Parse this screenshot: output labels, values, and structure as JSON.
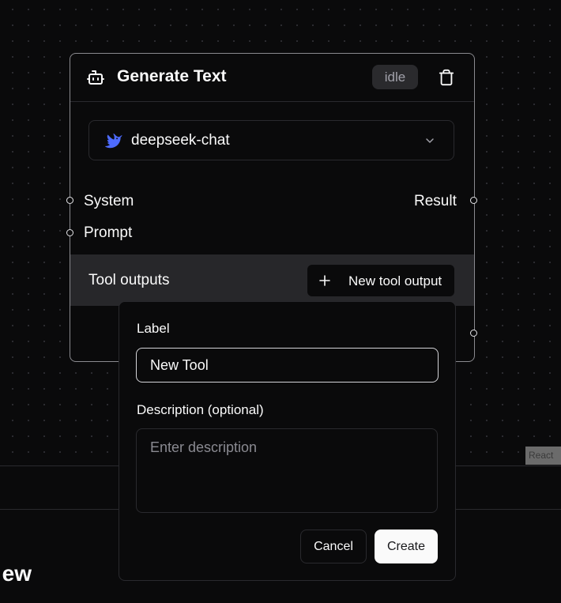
{
  "node": {
    "title": "Generate Text",
    "status": "idle",
    "model": {
      "name": "deepseek-chat",
      "icon": "deepseek-whale-icon",
      "icon_color": "#4d6bfe"
    },
    "inputs": [
      "System",
      "Prompt"
    ],
    "outputs": [
      "Result"
    ],
    "tool_outputs": {
      "label": "Tool outputs",
      "add_button": "New tool output"
    }
  },
  "popover": {
    "label_field": {
      "label": "Label",
      "value": "New Tool"
    },
    "description_field": {
      "label": "Description (optional)",
      "placeholder": "Enter description",
      "value": ""
    },
    "cancel_label": "Cancel",
    "create_label": "Create"
  },
  "background": {
    "partial_text": "ew",
    "badge": "React"
  }
}
